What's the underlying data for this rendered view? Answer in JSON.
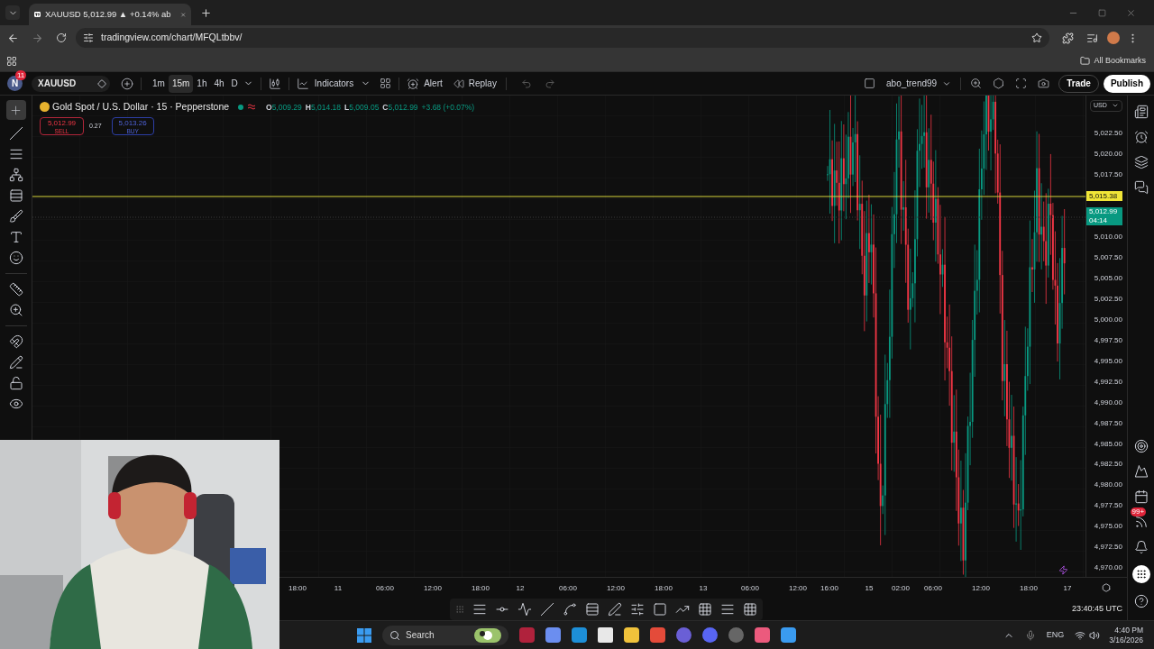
{
  "browser": {
    "tab_title": "XAUUSD 5,012.99 ▲ +0.14% ab",
    "url": "tradingview.com/chart/MFQLtbbv/",
    "bookmarks_label": "All Bookmarks"
  },
  "toolbar": {
    "avatar": "N",
    "avatar_badge": "11",
    "symbol": "XAUUSD",
    "intervals": [
      {
        "label": "1m",
        "selected": false
      },
      {
        "label": "15m",
        "selected": true
      },
      {
        "label": "1h",
        "selected": false
      },
      {
        "label": "4h",
        "selected": false
      },
      {
        "label": "D",
        "selected": false
      }
    ],
    "indicators": "Indicators",
    "alert": "Alert",
    "replay": "Replay",
    "layout_name": "abo_trend99",
    "trade": "Trade",
    "publish": "Publish"
  },
  "legend": {
    "title": "Gold Spot / U.S. Dollar · 15 · Pepperstone",
    "ohlc": [
      {
        "label": "O",
        "value": "5,009.29"
      },
      {
        "label": "H",
        "value": "5,014.18"
      },
      {
        "label": "L",
        "value": "5,009.05"
      },
      {
        "label": "C",
        "value": "5,012.99"
      }
    ],
    "change": "+3.68 (+0.07%)",
    "sell": {
      "price": "5,012.99",
      "label": "SELL"
    },
    "spread": "0.27",
    "buy": {
      "price": "5,013.26",
      "label": "BUY"
    }
  },
  "price_axis": {
    "currency": "USD",
    "labels": [
      "5,022.50",
      "5,020.00",
      "5,017.50",
      "5,010.00",
      "5,007.50",
      "5,005.00",
      "5,002.50",
      "5,000.00",
      "4,997.50",
      "4,995.00",
      "4,992.50",
      "4,990.00",
      "4,987.50",
      "4,985.00",
      "4,982.50",
      "4,980.00",
      "4,977.50",
      "4,975.00",
      "4,972.50",
      "4,970.00"
    ],
    "line_tag": "5,015.38",
    "last_price": "5,012.99",
    "countdown": "04:14"
  },
  "time_axis": [
    "18:00",
    "11",
    "06:00",
    "12:00",
    "18:00",
    "12",
    "06:00",
    "12:00",
    "18:00",
    "13",
    "06:00",
    "12:00",
    "16:00",
    "15",
    "02:00",
    "06:00",
    "12:00",
    "18:00",
    "17"
  ],
  "clock": "23:40:45 UTC",
  "sidebar_badge": "99+",
  "webcam": {
    "kind": "picture"
  },
  "taskbar": {
    "search": "Search",
    "language": "ENG",
    "time": "4:40 PM",
    "date": "3/16/2026"
  }
}
